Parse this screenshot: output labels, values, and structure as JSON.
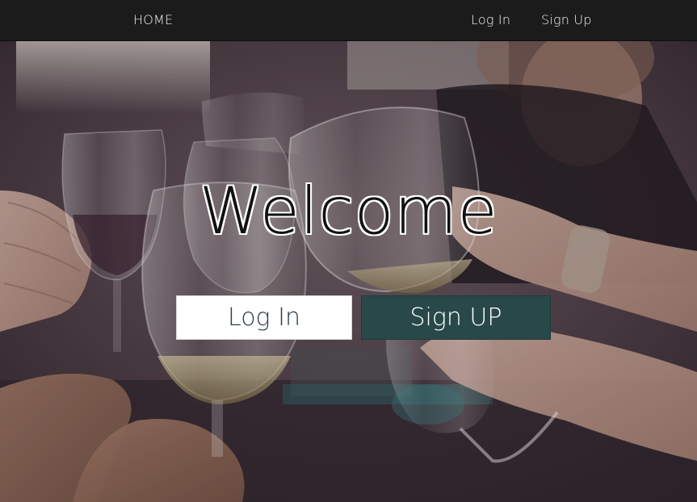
{
  "navbar": {
    "home_label": "HOME",
    "login_label": "Log In",
    "signup_label": "Sign Up"
  },
  "hero": {
    "title": "Welcome",
    "login_button": "Log In",
    "signup_button": "Sign UP"
  },
  "colors": {
    "navbar_bg": "#1b1b1b",
    "signup_button_bg": "#284849",
    "login_button_bg": "#ffffff"
  }
}
